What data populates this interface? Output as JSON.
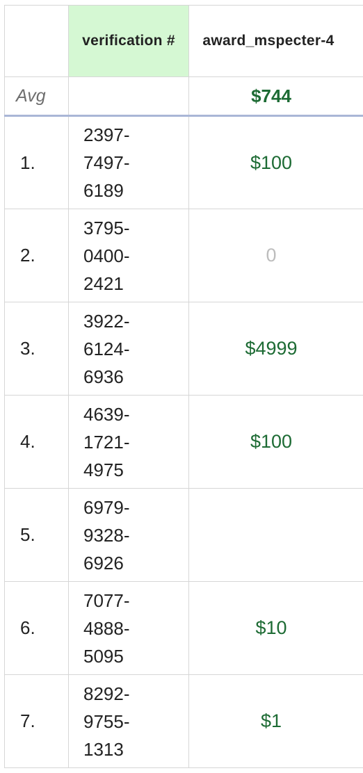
{
  "table": {
    "columns": {
      "index": "",
      "verification": "verification #",
      "award": "award_mspecter-4"
    },
    "avg_label": "Avg",
    "avg_award": "$744",
    "rows": [
      {
        "index": "1.",
        "verification": [
          "2397-",
          "7497-",
          "6189"
        ],
        "award": "$100"
      },
      {
        "index": "2.",
        "verification": [
          "3795-",
          "0400-",
          "2421"
        ],
        "award": "0"
      },
      {
        "index": "3.",
        "verification": [
          "3922-",
          "6124-",
          "6936"
        ],
        "award": "$4999"
      },
      {
        "index": "4.",
        "verification": [
          "4639-",
          "1721-",
          "4975"
        ],
        "award": "$100"
      },
      {
        "index": "5.",
        "verification": [
          "6979-",
          "9328-",
          "6926"
        ],
        "award": ""
      },
      {
        "index": "6.",
        "verification": [
          "7077-",
          "4888-",
          "5095"
        ],
        "award": "$10"
      },
      {
        "index": "7.",
        "verification": [
          "8292-",
          "9755-",
          "1313"
        ],
        "award": "$1"
      }
    ]
  },
  "colors": {
    "header_highlight": "#d5f8d3",
    "award_green": "#1d6b34",
    "zero_gray": "#bdbdbd",
    "avg_divider": "#a9b6d6"
  }
}
